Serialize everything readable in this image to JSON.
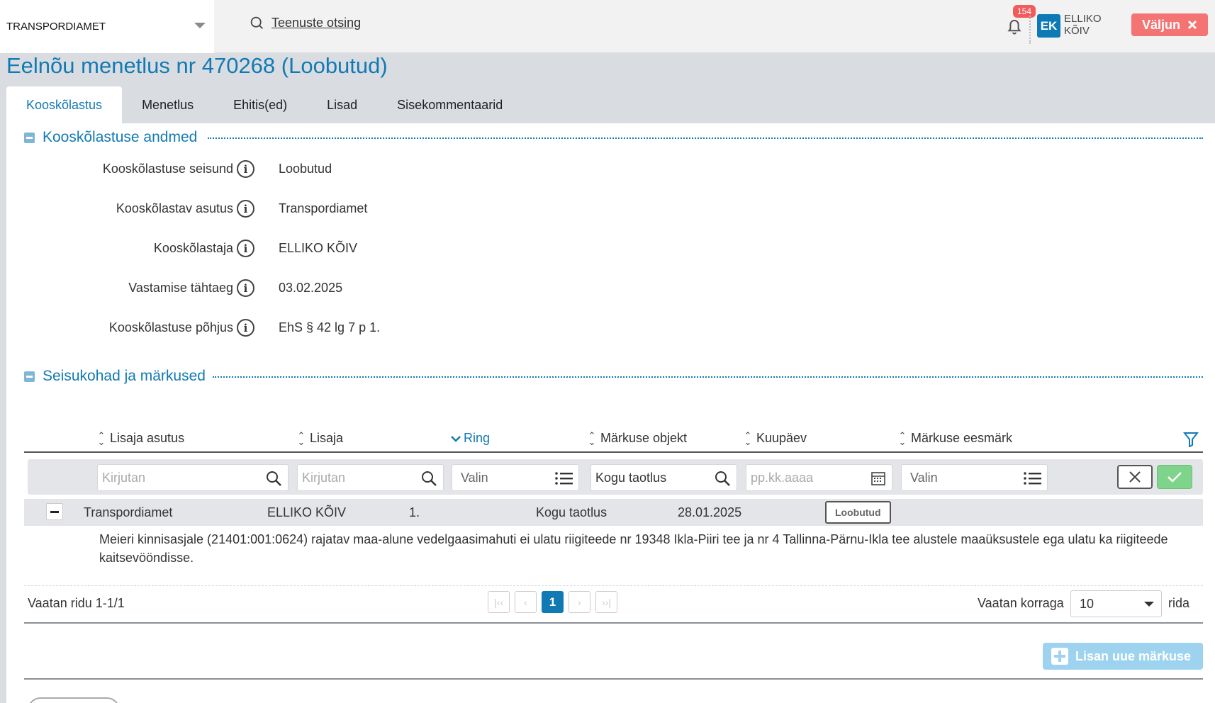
{
  "topbar": {
    "org": "TRANSPORDIAMET",
    "search_label": "Teenuste otsing",
    "notifications_count": "154",
    "user_initials": "EK",
    "user_name": "ELLIKO KÕIV",
    "logout_label": "Väljun"
  },
  "page": {
    "title": "Eelnõu menetlus nr 470268 (Loobutud)",
    "tabs": [
      "Kooskõlastus",
      "Menetlus",
      "Ehitis(ed)",
      "Lisad",
      "Sisekommentaarid"
    ],
    "active_tab": "Kooskõlastus"
  },
  "approval": {
    "section_title": "Kooskõlastuse andmed",
    "fields": [
      {
        "label": "Kooskõlastuse seisund",
        "value": "Loobutud"
      },
      {
        "label": "Kooskõlastav asutus",
        "value": "Transpordiamet"
      },
      {
        "label": "Kooskõlastaja",
        "value": "ELLIKO KÕIV"
      },
      {
        "label": "Vastamise tähtaeg",
        "value": "03.02.2025"
      },
      {
        "label": "Kooskõlastuse põhjus",
        "value": "EhS § 42 lg 7 p 1."
      }
    ]
  },
  "remarks": {
    "section_title": "Seisukohad ja märkused",
    "columns": [
      "Lisaja asutus",
      "Lisaja",
      "Ring",
      "Märkuse objekt",
      "Kuupäev",
      "Märkuse eesmärk"
    ],
    "sorted_column": "Ring",
    "filters": {
      "agency_placeholder": "Kirjutan",
      "author_placeholder": "Kirjutan",
      "round_value": "Valin",
      "object_value": "Kogu taotlus",
      "date_placeholder": "pp.kk.aaaa",
      "purpose_value": "Valin"
    },
    "rows": [
      {
        "agency": "Transpordiamet",
        "author": "ELLIKO KÕIV",
        "round": "1.",
        "object": "Kogu taotlus",
        "date": "28.01.2025",
        "purpose": "Loobutud",
        "text": "Meieri kinnisasjale (21401:001:0624) rajatav maa-alune vedelgaasimahuti ei ulatu riigiteede nr 19348 Ikla-Piiri tee ja nr 4 Tallinna-Pärnu-Ikla tee alustele maaüksustele ega ulatu ka riigiteede kaitsevööndisse."
      }
    ],
    "pager": {
      "summary": "Vaatan ridu 1-1/1",
      "current_page": "1",
      "per_page_label": "Vaatan korraga",
      "per_page_value": "10",
      "per_page_suffix": "rida"
    },
    "add_label": "Lisan uue märkuse"
  },
  "colors": {
    "accent": "#127ab3",
    "logout": "#f47373",
    "confirm": "#7fd48b",
    "add_disabled": "#9dd3ee"
  }
}
